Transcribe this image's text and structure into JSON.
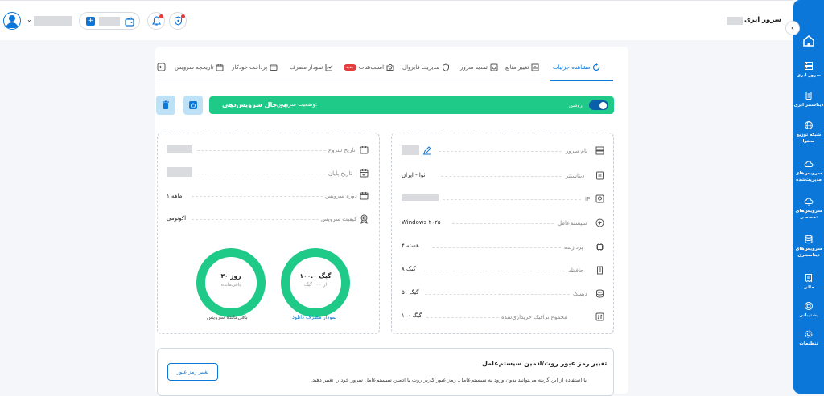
{
  "header": {
    "title": "سرور ابری"
  },
  "tabs": [
    {
      "label": "مشاهده جزئیات"
    },
    {
      "label": "تغییر منابع"
    },
    {
      "label": "تمدید سرور"
    },
    {
      "label": "مدیریت فایروال"
    },
    {
      "label": "اسنپ‌شات"
    },
    {
      "label": "نمودار مصرف"
    },
    {
      "label": "پرداخت خودکار"
    },
    {
      "label": "تاریخچه سرویس"
    }
  ],
  "snapshot_badge": "جدید",
  "status": {
    "toggle_label": "روشن",
    "label": "وضعیت سرویس:",
    "value": "در حال سرویس‌دهی"
  },
  "server_info": [
    {
      "label": "نام سرور",
      "value": ""
    },
    {
      "label": "دیتاسنتر",
      "value": "ثوا - ایران"
    },
    {
      "label": "IP",
      "value": ""
    },
    {
      "label": "سیستم‌عامل",
      "value": "Windows ۲۰۲۵"
    },
    {
      "label": "پردازنده",
      "value": "۴ هسته"
    },
    {
      "label": "حافظه",
      "value": "۸ گیگ"
    },
    {
      "label": "دیسک",
      "value": "۵۰ گیگ"
    },
    {
      "label": "مجموع ترافیک خریداری‌شده",
      "value": "۱۰۰ گیگ"
    }
  ],
  "service_info": [
    {
      "label": "تاریخ شروع",
      "value": ""
    },
    {
      "label": "تاریخ پایان",
      "value": ""
    },
    {
      "label": "دوره سرویس",
      "value": "۱ ماهه"
    },
    {
      "label": "کیفیت سرویس",
      "value": "اکونومی"
    }
  ],
  "download_chart": {
    "value": "۱۰۰.۰ گیگ",
    "sub": "از ۱۰۰ گیگ",
    "caption": "نمودار مصرف دانلود",
    "fraction": 1
  },
  "remaining_chart": {
    "value": "۳۰ روز",
    "sub": "باقی‌مانده",
    "caption": "باقی‌مانده سرویس",
    "fraction": 1
  },
  "password_section": {
    "title": "تغییر رمز عبور روت/ادمین سیستم‌عامل",
    "desc": "با استفاده از این گزینه می‌توانید بدون ورود به سیستم‌عامل، رمز عبور کاربر روت یا ادمین سیستم‌عامل سرور خود را تغییر دهید.",
    "button": "تغییر رمز عبور"
  },
  "sidebar": {
    "items": [
      {
        "label": "سرور ابری"
      },
      {
        "label": "دیتاسنتر ابری"
      },
      {
        "label": "شبکه توزیع محتوا"
      },
      {
        "label": "سرویس‌های مدیریت‌شده"
      },
      {
        "label": "سرویس‌های تخصصی"
      },
      {
        "label": "سرویس‌های دیتاسنتری"
      },
      {
        "label": "مالی"
      },
      {
        "label": "پشتیبانی"
      },
      {
        "label": "تنظیمات"
      }
    ]
  },
  "colors": {
    "primary": "#0b77d9",
    "success": "#1fc987",
    "danger": "#e23c3c"
  }
}
